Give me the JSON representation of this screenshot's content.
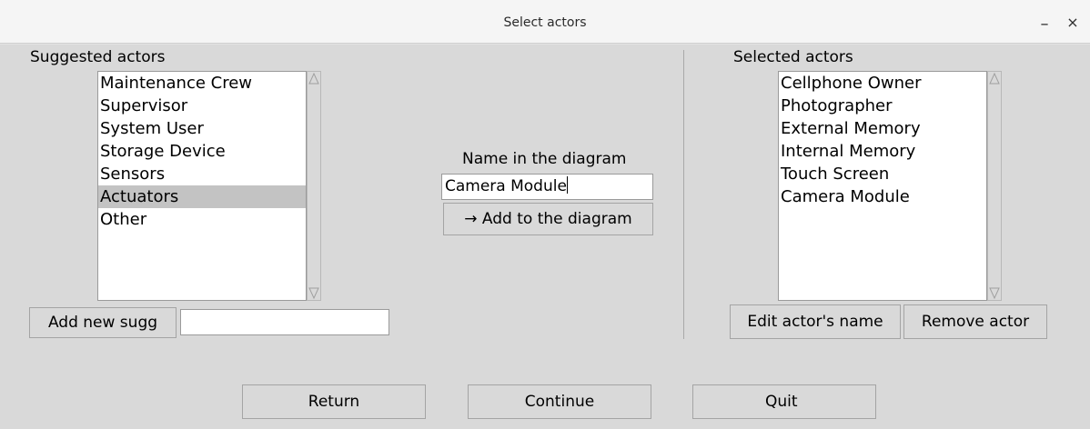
{
  "window": {
    "title": "Select actors",
    "minimize_glyph": "–",
    "close_glyph": "×"
  },
  "suggested": {
    "label": "Suggested actors",
    "items": [
      "Maintenance Crew",
      "Supervisor",
      "System User",
      "Storage Device",
      "Sensors",
      "Actuators",
      "Other"
    ],
    "selected_index": 5,
    "add_button": "Add new sugg",
    "add_input_value": ""
  },
  "center": {
    "label": "Name in the diagram",
    "name_value": "Camera Module",
    "add_button": "→ Add to the diagram"
  },
  "selected": {
    "label": "Selected actors",
    "items": [
      "Cellphone Owner",
      "Photographer",
      "External Memory",
      "Internal Memory",
      "Touch Screen",
      "Camera Module"
    ],
    "edit_button": "Edit actor's name",
    "remove_button": "Remove actor"
  },
  "footer": {
    "return_button": "Return",
    "continue_button": "Continue",
    "quit_button": "Quit"
  },
  "icons": {
    "scroll_up": "triangle-up-icon",
    "scroll_down": "triangle-down-icon"
  }
}
